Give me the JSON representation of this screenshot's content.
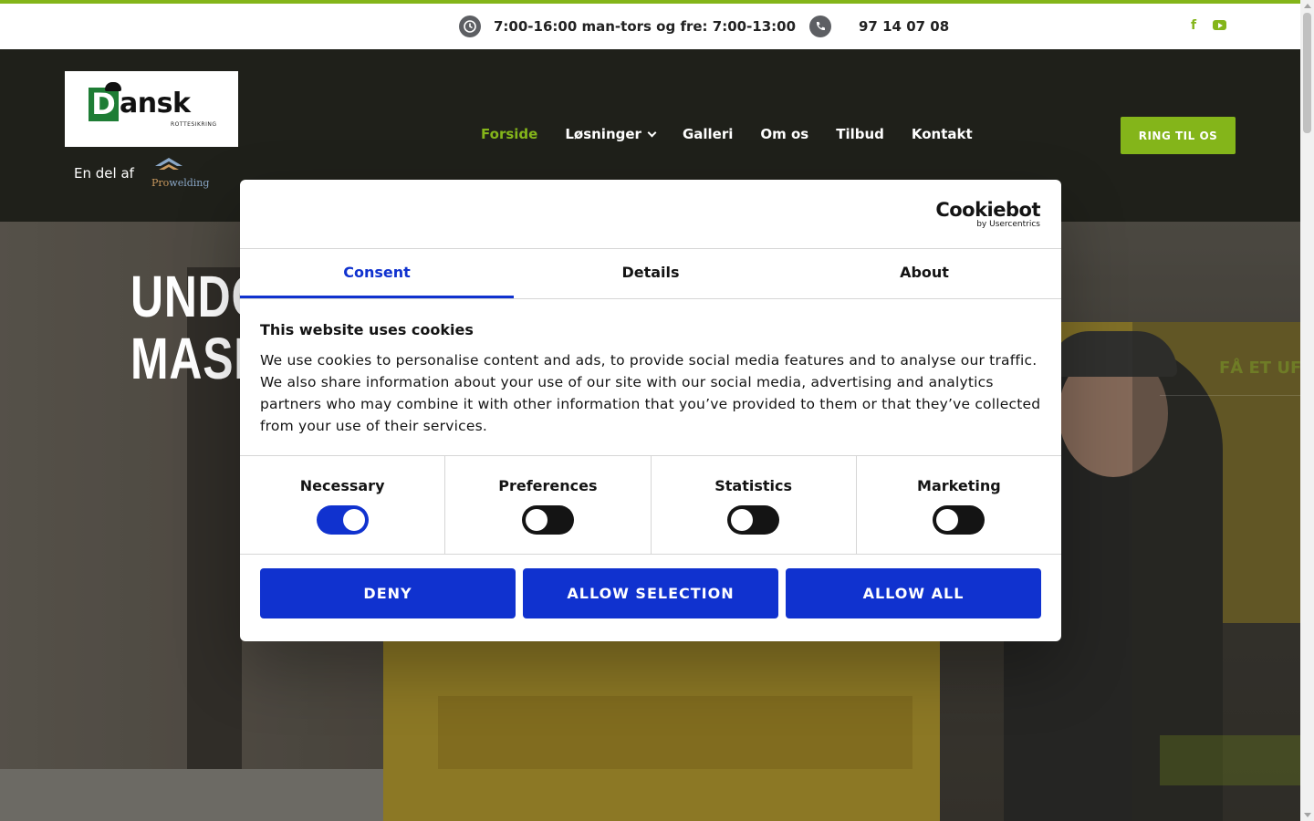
{
  "topbar": {
    "hours_icon": "clock-icon",
    "hours": "7:00-16:00 man-tors og fre: 7:00-13:00",
    "phone_icon": "phone-icon",
    "phone": "97 14 07 08",
    "social": [
      "facebook-icon",
      "youtube-icon"
    ],
    "accent": "#84b51a"
  },
  "header": {
    "logo": {
      "word": "ansk",
      "letter": "D",
      "sub": "ROTTESIKRING"
    },
    "part_of": "En del af",
    "partner": {
      "name_a": "Pro",
      "name_b": "welding"
    },
    "nav": [
      {
        "label": "Forside",
        "active": true
      },
      {
        "label": "Løsninger",
        "dropdown": true
      },
      {
        "label": "Galleri"
      },
      {
        "label": "Om os"
      },
      {
        "label": "Tilbud"
      },
      {
        "label": "Kontakt"
      }
    ],
    "cta": "RING TIL OS"
  },
  "hero": {
    "title_line1": "UNDG",
    "title_line2": "MASK",
    "side_title": "FÅ ET UFOR"
  },
  "cookie_dialog": {
    "brand": "Cookiebot",
    "brand_sub": "by Usercentrics",
    "tabs": [
      "Consent",
      "Details",
      "About"
    ],
    "active_tab": "Consent",
    "heading": "This website uses cookies",
    "text": "We use cookies to personalise content and ads, to provide social media features and to analyse our traffic. We also share information about your use of our site with our social media, advertising and analytics partners who may combine it with other information that you’ve provided to them or that they’ve collected from your use of their services.",
    "categories": [
      {
        "label": "Necessary",
        "enabled": true
      },
      {
        "label": "Preferences",
        "enabled": false
      },
      {
        "label": "Statistics",
        "enabled": false
      },
      {
        "label": "Marketing",
        "enabled": false
      }
    ],
    "buttons": [
      "DENY",
      "ALLOW SELECTION",
      "ALLOW ALL"
    ],
    "primary_color": "#1032cf"
  }
}
